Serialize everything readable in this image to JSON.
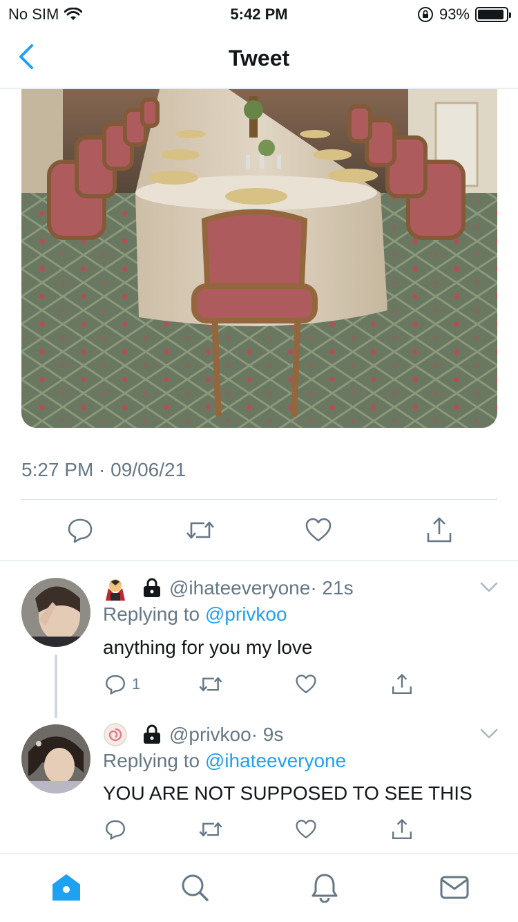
{
  "status_bar": {
    "carrier": "No SIM",
    "time": "5:42 PM",
    "battery_percent": "93%",
    "battery_level": 0.93
  },
  "nav": {
    "title": "Tweet"
  },
  "tweet": {
    "timestamp": "5:27 PM · 09/06/21"
  },
  "replies": [
    {
      "handle": "@ihateeveryone",
      "time_ago": "· 21s",
      "replying_prefix": "Replying to",
      "replying_to": "@privkoo",
      "text": "anything for you my love",
      "reply_count": "1",
      "emoji_icon": "vampire-emoji-icon"
    },
    {
      "handle": "@privkoo",
      "time_ago": "· 9s",
      "replying_prefix": "Replying to",
      "replying_to": "@ihateeveryone",
      "text": "YOU ARE NOT SUPPOSED TO SEE THIS",
      "reply_count": "",
      "emoji_icon": "fish-cake-emoji-icon"
    }
  ],
  "colors": {
    "accent": "#1da1f2",
    "secondary_text": "#657786",
    "divider": "#d5dbe0"
  }
}
